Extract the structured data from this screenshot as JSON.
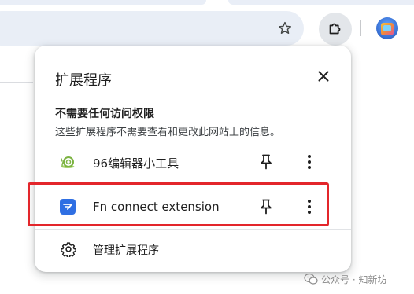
{
  "browser": {
    "toolbar": {
      "bookmark_icon": "star-icon",
      "extensions_icon": "puzzle-icon",
      "profile_icon": "avatar"
    }
  },
  "extensions_popup": {
    "title": "扩展程序",
    "close_icon": "close-icon",
    "section_heading": "不需要任何访问权限",
    "section_description": "这些扩展程序不需要查看和更改此网站上的信息。",
    "items": [
      {
        "name": "96编辑器小工具",
        "icon": "snail-icon",
        "pin_icon": "pin-icon",
        "more_icon": "more-vert-icon"
      },
      {
        "name": "Fn connect extension",
        "icon": "fn-connect-icon",
        "pin_icon": "pin-icon",
        "more_icon": "more-vert-icon",
        "highlighted": true
      }
    ],
    "manage": {
      "label": "管理扩展程序",
      "icon": "gear-icon"
    }
  },
  "watermark": {
    "text": "公众号 · 知新坊"
  },
  "colors": {
    "highlight": "#e3262b",
    "toolbar_bg": "#e9eef6",
    "fn_icon": "#2f6fe3",
    "snail_green": "#7cb342"
  }
}
